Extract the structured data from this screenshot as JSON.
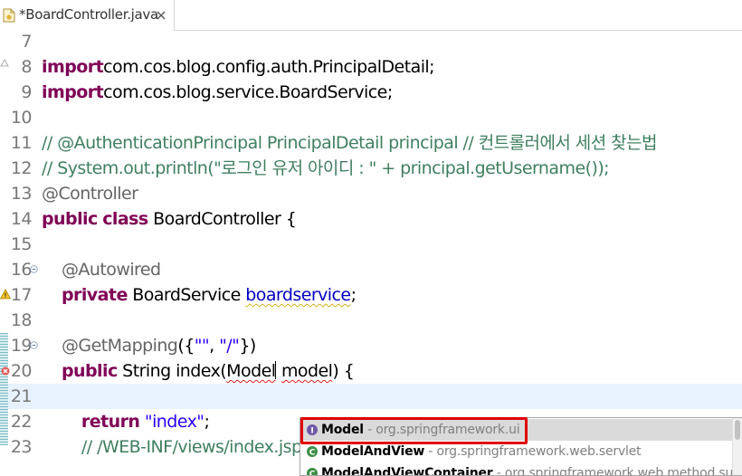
{
  "tab": {
    "label": "*BoardController.java",
    "file_icon": "java-file-icon",
    "close_icon": "close-icon"
  },
  "editor": {
    "lines": [
      {
        "num": "7"
      },
      {
        "num": "8",
        "t": [
          [
            "kw",
            "import"
          ],
          [
            "",
            "com.cos.blog.config.auth.PrincipalDetail;"
          ]
        ]
      },
      {
        "num": "9",
        "t": [
          [
            "kw",
            "import"
          ],
          [
            "",
            "com.cos.blog.service.BoardService;"
          ]
        ]
      },
      {
        "num": "10"
      },
      {
        "num": "11",
        "t": [
          [
            "cm",
            "// @AuthenticationPrincipal PrincipalDetail principal // 컨트롤러에서 세션 찾는법"
          ]
        ]
      },
      {
        "num": "12",
        "t": [
          [
            "cm",
            "// System.out.println(\"로그인 유저 아이디 : \" + principal.getUsername());"
          ]
        ]
      },
      {
        "num": "13",
        "t": [
          [
            "an",
            "@Controller"
          ]
        ]
      },
      {
        "num": "14",
        "t": [
          [
            "kw",
            "public"
          ],
          [
            "",
            " "
          ],
          [
            "kw",
            "class"
          ],
          [
            "",
            " BoardController {"
          ]
        ]
      },
      {
        "num": "15"
      },
      {
        "num": "16",
        "t": [
          [
            "",
            "    "
          ],
          [
            "an",
            "@Autowired"
          ]
        ]
      },
      {
        "num": "17",
        "t": [
          [
            "",
            "    "
          ],
          [
            "kw",
            "private"
          ],
          [
            "",
            " BoardService "
          ],
          [
            "fld warn-ul",
            "boardservice"
          ],
          [
            "",
            ";"
          ]
        ]
      },
      {
        "num": "18"
      },
      {
        "num": "19",
        "t": [
          [
            "",
            "    "
          ],
          [
            "an",
            "@GetMapping"
          ],
          [
            "",
            "({"
          ],
          [
            "st",
            "\"\""
          ],
          [
            "",
            ", "
          ],
          [
            "st",
            "\"/\""
          ],
          [
            "",
            "})"
          ]
        ]
      },
      {
        "num": "20",
        "t": [
          [
            "",
            "    "
          ],
          [
            "kw",
            "public"
          ],
          [
            "",
            " String index("
          ],
          [
            "err-ul",
            "Model"
          ],
          [
            "caret",
            ""
          ],
          [
            "",
            " "
          ],
          [
            "err-ul",
            "model"
          ],
          [
            "",
            ") {"
          ]
        ]
      },
      {
        "num": "21"
      },
      {
        "num": "22",
        "t": [
          [
            "",
            "        "
          ],
          [
            "kw",
            "return"
          ],
          [
            "",
            " "
          ],
          [
            "st",
            "\"index\""
          ],
          [
            "",
            ";"
          ]
        ]
      },
      {
        "num": "23",
        "t": [
          [
            "",
            "        "
          ],
          [
            "cm",
            "// /WEB-INF/views/index.jsp"
          ]
        ]
      }
    ]
  },
  "assist": {
    "items": [
      {
        "name": "Model",
        "sep": " - ",
        "pkg": "org.springframework.ui",
        "icon": "interface-icon",
        "selected": true
      },
      {
        "name": "ModelAndView",
        "sep": " - ",
        "pkg": "org.springframework.web.servlet",
        "icon": "class-icon",
        "selected": false
      },
      {
        "name": "ModelAndViewContainer",
        "sep": " - ",
        "pkg": "org.springframework.web.method.support",
        "icon": "class-icon",
        "selected": false
      }
    ]
  },
  "colors": {
    "keyword": "#7f0055",
    "comment": "#3f7f5f",
    "annotation": "#646464",
    "string": "#2a00ff",
    "field": "#0000c0",
    "current_line": "#e8f2fe",
    "highlight_box": "#e00000"
  }
}
